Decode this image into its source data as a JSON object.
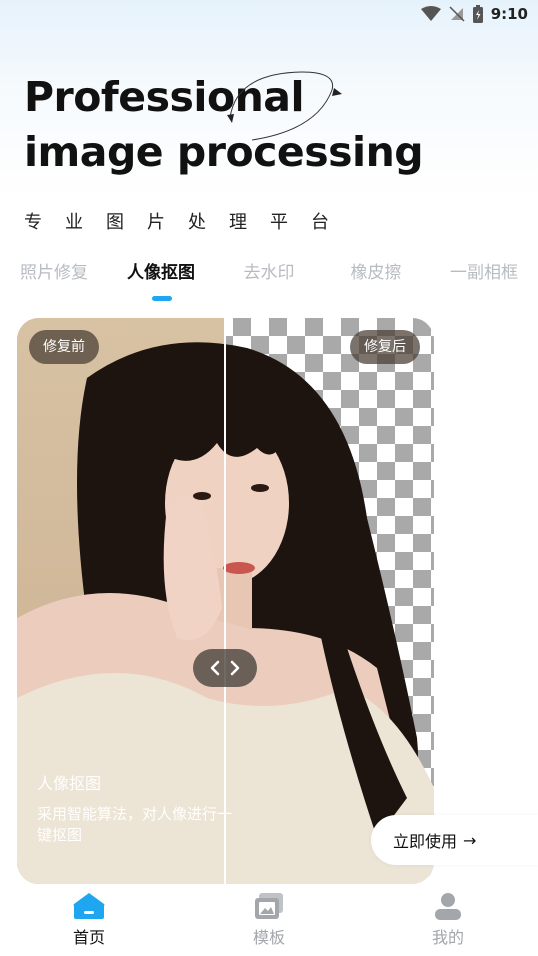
{
  "status_bar": {
    "time": "9:10"
  },
  "hero": {
    "title_line1": "Professional",
    "title_line2": "image processing",
    "subtitle": "专业图片处理平台"
  },
  "tabs": [
    {
      "label": "照片修复",
      "active": false
    },
    {
      "label": "人像抠图",
      "active": true
    },
    {
      "label": "去水印",
      "active": false
    },
    {
      "label": "橡皮擦",
      "active": false
    },
    {
      "label": "一副相框",
      "active": false
    }
  ],
  "compare": {
    "before_badge": "修复前",
    "after_badge": "修复后",
    "caption_title": "人像抠图",
    "caption_desc": "采用智能算法，对人像进行一键抠图"
  },
  "cta": {
    "label": "立即使用",
    "arrow": "→"
  },
  "bottom_nav": [
    {
      "label": "首页",
      "icon": "home-icon",
      "active": true
    },
    {
      "label": "模板",
      "icon": "template-icon",
      "active": false
    },
    {
      "label": "我的",
      "icon": "profile-icon",
      "active": false
    }
  ],
  "colors": {
    "accent": "#1ea7f0",
    "inactive": "#a3a6ab"
  }
}
